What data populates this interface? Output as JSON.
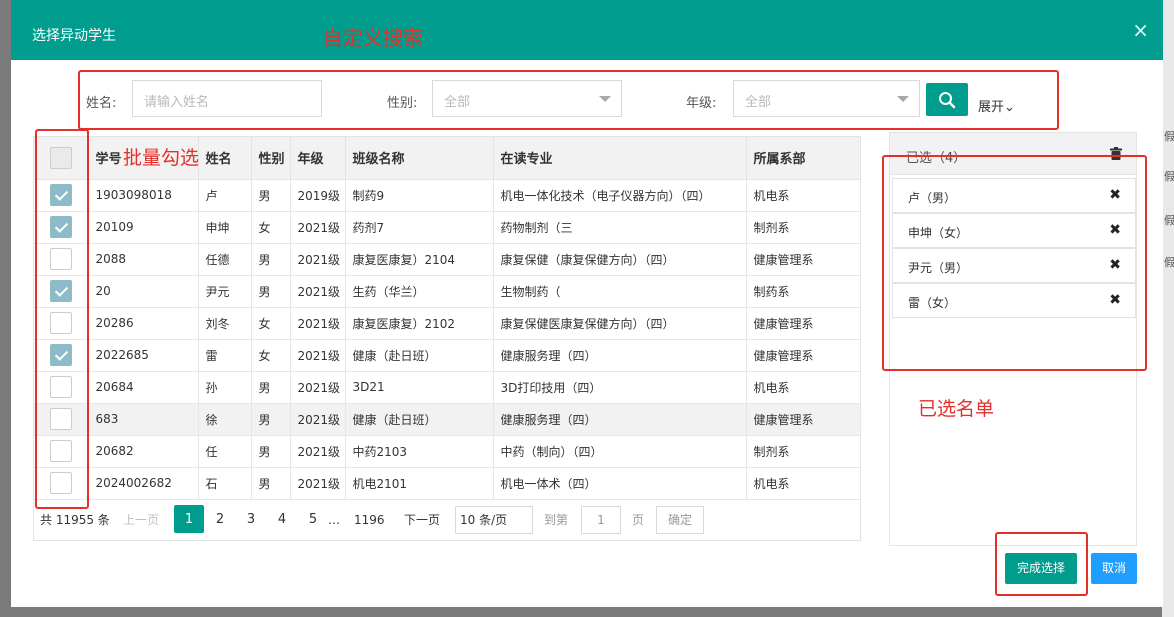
{
  "modal": {
    "title": "选择异动学生",
    "close_label": "×"
  },
  "annotations": {
    "custom_search": "自定义搜索",
    "batch_select": "批量勾选",
    "selected_list": "已选名单"
  },
  "search": {
    "name_label": "姓名:",
    "name_placeholder": "请输入姓名",
    "gender_label": "性别:",
    "gender_value": "全部",
    "grade_label": "年级:",
    "grade_value": "全部",
    "expand_label": "展开⌄"
  },
  "table": {
    "headers": [
      "学号",
      "姓名",
      "性别",
      "年级",
      "班级名称",
      "在读专业",
      "所属系部"
    ],
    "rows": [
      {
        "checked": true,
        "highlight": false,
        "cells": [
          "1903098018",
          "卢",
          "男",
          "2019级",
          "制药9",
          "机电一体化技术（电子仪器方向）（四）",
          "机电系"
        ]
      },
      {
        "checked": true,
        "highlight": false,
        "cells": [
          "20109",
          "申坤",
          "女",
          "2021级",
          "药剂7",
          "药物制剂（三",
          "制剂系"
        ]
      },
      {
        "checked": false,
        "highlight": false,
        "cells": [
          "2088",
          "任德",
          "男",
          "2021级",
          "康复医康复）2104",
          "康复保健（康复保健方向）（四）",
          "健康管理系"
        ]
      },
      {
        "checked": true,
        "highlight": false,
        "cells": [
          "20",
          "尹元",
          "男",
          "2021级",
          "生药（华兰）",
          "生物制药（",
          "制药系"
        ]
      },
      {
        "checked": false,
        "highlight": false,
        "cells": [
          "20286",
          "刘冬",
          "女",
          "2021级",
          "康复医康复）2102",
          "康复保健医康复保健方向）（四）",
          "健康管理系"
        ]
      },
      {
        "checked": true,
        "highlight": false,
        "cells": [
          "2022685",
          "雷",
          "女",
          "2021级",
          "健康（赴日班）",
          "健康服务理（四）",
          "健康管理系"
        ]
      },
      {
        "checked": false,
        "highlight": false,
        "cells": [
          "20684",
          "孙",
          "男",
          "2021级",
          "3D21",
          "3D打印技用（四）",
          "机电系"
        ]
      },
      {
        "checked": false,
        "highlight": true,
        "cells": [
          "683",
          "徐",
          "男",
          "2021级",
          "健康（赴日班）",
          "健康服务理（四）",
          "健康管理系"
        ]
      },
      {
        "checked": false,
        "highlight": false,
        "cells": [
          "20682",
          "任",
          "男",
          "2021级",
          "中药2103",
          "中药（制向）（四）",
          "制剂系"
        ]
      },
      {
        "checked": false,
        "highlight": false,
        "cells": [
          "2024002682",
          "石",
          "男",
          "2021级",
          "机电2101",
          "机电一体术（四）",
          "机电系"
        ]
      }
    ]
  },
  "pager": {
    "total": "共 11955 条",
    "prev": "上一页",
    "pages": [
      "1",
      "2",
      "3",
      "4",
      "5"
    ],
    "ellipsis": "…",
    "last": "1196",
    "next": "下一页",
    "page_size": "10 条/页",
    "goto_label": "到第",
    "goto_value": "1",
    "page_unit": "页",
    "confirm": "确定"
  },
  "selected": {
    "title": "已选（4）",
    "items": [
      {
        "name": "卢（男）"
      },
      {
        "name": "申坤（女）"
      },
      {
        "name": "尹元（男）"
      },
      {
        "name": "雷（女）"
      }
    ]
  },
  "footer": {
    "done_label": "完成选择",
    "cancel_label": "取消"
  },
  "colors": {
    "header_teal": "#009d8f",
    "cancel_blue": "#1e9fff",
    "annotation_red": "#e5302a"
  },
  "bg_chars": [
    "假",
    "假",
    "假",
    "假"
  ]
}
